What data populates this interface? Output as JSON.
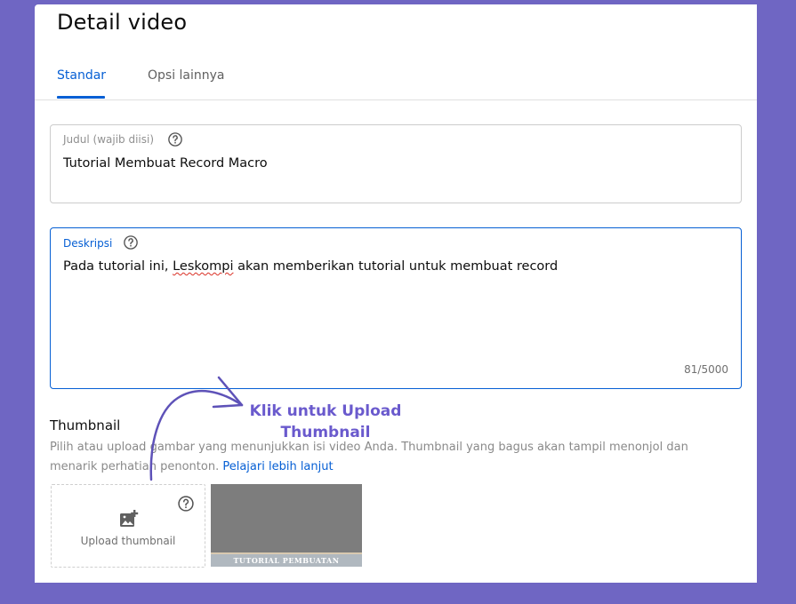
{
  "header": {
    "title": "Detail video"
  },
  "tabs": [
    {
      "label": "Standar",
      "active": true
    },
    {
      "label": "Opsi lainnya",
      "active": false
    }
  ],
  "title_field": {
    "label": "Judul (wajib diisi)",
    "value": "Tutorial Membuat Record Macro",
    "help_icon": "help-circle-icon"
  },
  "description_field": {
    "label": "Deskripsi",
    "value_prefix": "Pada tutorial ini, ",
    "value_misspelled": "Leskompi",
    "value_suffix": " akan memberikan tutorial untuk membuat record",
    "counter": "81/5000",
    "help_icon": "help-circle-icon"
  },
  "thumbnail": {
    "title": "Thumbnail",
    "description": "Pilih atau upload gambar yang menunjukkan isi video Anda. Thumbnail yang bagus akan tampil menonjol dan menarik perhatian penonton.",
    "learn_more": "Pelajari lebih lanjut",
    "upload_label": "Upload thumbnail",
    "upload_icon": "add-photo-icon",
    "preview_caption": "TUTORIAL PEMBUATAN"
  },
  "annotation": {
    "text": "Klik untuk Upload Thumbnail",
    "color": "#6a5acd"
  },
  "colors": {
    "background": "#6f66c3",
    "accent": "#065fd4"
  }
}
